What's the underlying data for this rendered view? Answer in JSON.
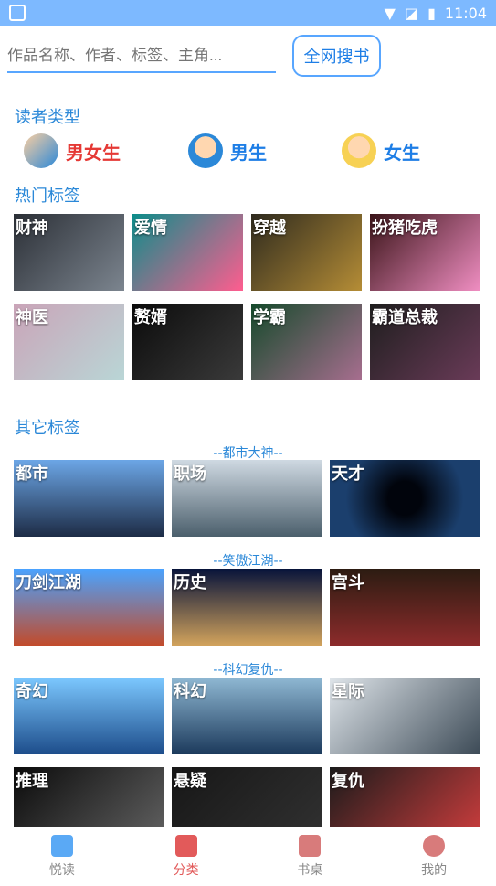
{
  "status_bar": {
    "time": "11:04"
  },
  "search": {
    "placeholder": "作品名称、作者、标签、主角...",
    "button": "全网搜书"
  },
  "reader_types": {
    "title": "读者类型",
    "items": [
      {
        "label": "男女生",
        "color": "#e53935"
      },
      {
        "label": "男生",
        "color": "#1e7ee6"
      },
      {
        "label": "女生",
        "color": "#1e7ee6"
      }
    ]
  },
  "hot_tags": {
    "title": "热门标签",
    "items": [
      "财神",
      "爱情",
      "穿越",
      "扮猪吃虎",
      "神医",
      "赘婿",
      "学霸",
      "霸道总裁"
    ]
  },
  "other_tags": {
    "title": "其它标签",
    "groups": [
      {
        "label": "--都市大神--",
        "items": [
          "都市",
          "职场",
          "天才"
        ]
      },
      {
        "label": "--笑傲江湖--",
        "items": [
          "刀剑江湖",
          "历史",
          "宫斗"
        ]
      },
      {
        "label": "--科幻复仇--",
        "items": [
          "奇幻",
          "科幻",
          "星际"
        ]
      },
      {
        "label": "",
        "items": [
          "推理",
          "悬疑",
          "复仇"
        ]
      }
    ]
  },
  "nav": {
    "items": [
      {
        "label": "悦读"
      },
      {
        "label": "分类"
      },
      {
        "label": "书桌"
      },
      {
        "label": "我的"
      }
    ]
  }
}
